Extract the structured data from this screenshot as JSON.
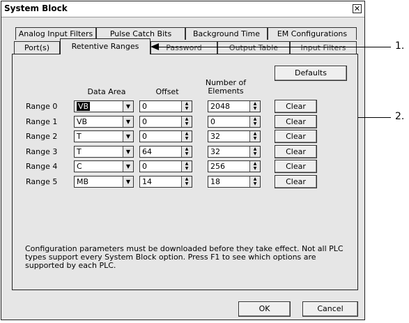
{
  "window": {
    "title": "System Block",
    "close_glyph": "✕"
  },
  "tabs_back": [
    {
      "label": "Analog Input Filters"
    },
    {
      "label": "Pulse Catch Bits"
    },
    {
      "label": "Background Time"
    },
    {
      "label": "EM Configurations"
    }
  ],
  "tabs_front": [
    {
      "label": "Port(s)"
    },
    {
      "label": "Retentive Ranges",
      "active": true
    },
    {
      "label": "Password"
    },
    {
      "label": "Output Table"
    },
    {
      "label": "Input Filters"
    }
  ],
  "panel": {
    "defaults_label": "Defaults",
    "headers": {
      "data_area": "Data Area",
      "offset": "Offset",
      "elements": "Number of Elements"
    },
    "clear_label": "Clear",
    "rows": [
      {
        "label": "Range 0",
        "area": "VB",
        "offset": "0",
        "elements": "2048"
      },
      {
        "label": "Range 1",
        "area": "VB",
        "offset": "0",
        "elements": "0"
      },
      {
        "label": "Range 2",
        "area": "T",
        "offset": "0",
        "elements": "32"
      },
      {
        "label": "Range 3",
        "area": "T",
        "offset": "64",
        "elements": "32"
      },
      {
        "label": "Range 4",
        "area": "C",
        "offset": "0",
        "elements": "256"
      },
      {
        "label": "Range 5",
        "area": "MB",
        "offset": "14",
        "elements": "18"
      }
    ],
    "note": "Configuration parameters must be downloaded before they take effect. Not all PLC types support every System Block option.  Press F1 to see which options are supported by each PLC."
  },
  "buttons": {
    "ok": "OK",
    "cancel": "Cancel"
  },
  "callouts": [
    {
      "label": "1."
    },
    {
      "label": "2."
    }
  ]
}
